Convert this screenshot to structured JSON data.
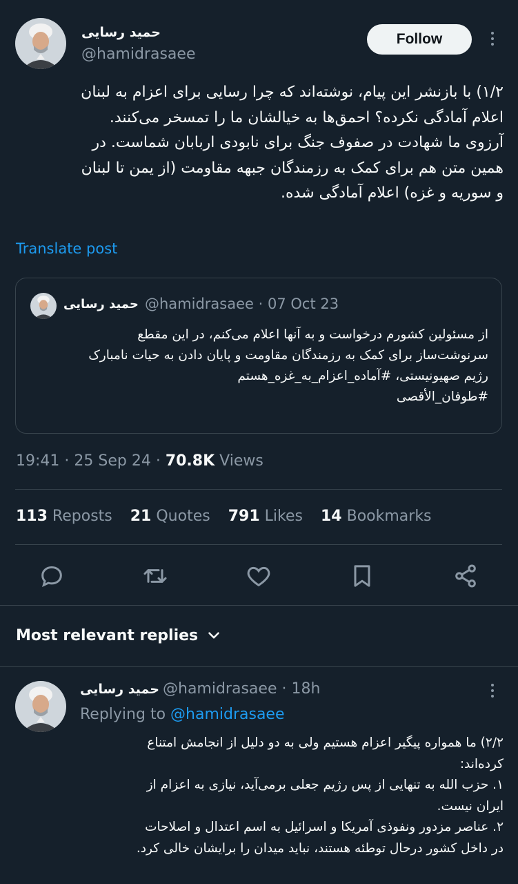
{
  "tweet": {
    "author_name": "حمید رسایی",
    "handle": "@hamidrasaee",
    "follow_label": "Follow",
    "text_lines": [
      "۱/۲) با بازنشر این پیام، نوشته‌اند که چرا رسایی برای اعزام به لبنان",
      "اعلام آمادگی نکرده؟ احمق‌ها به خیالشان ما را تمسخر می‌کنند.",
      "آرزوی ما شهادت در صفوف جنگ برای نابودی اربابان شماست. در",
      "همین متن هم برای کمک به رزمندگان جبهه مقاومت (از یمن تا لبنان",
      "و سوریه و غزه) اعلام آمادگی شده."
    ],
    "translate_label": "Translate post",
    "time": "19:41 · 25 Sep 24 · ",
    "views_count": "70.8K",
    "views_label": " Views"
  },
  "quote": {
    "author_name": "حمید رسایی",
    "handle_date": "@hamidrasaee · 07 Oct 23",
    "text_lines": [
      "از مسئولین کشورم درخواست و به آنها اعلام می‌کنم، در این مقطع",
      "سرنوشت‌ساز برای کمک به رزمندگان مقاومت و پایان دادن به حیات نامبارک",
      "رژیم صهیونیستی، #آماده_اعزام_به_غزه_هستم",
      "#طوفان_الأقصی"
    ]
  },
  "stats": [
    {
      "count": "113",
      "label": " Reposts"
    },
    {
      "count": "21",
      "label": " Quotes"
    },
    {
      "count": "791",
      "label": " Likes"
    },
    {
      "count": "14",
      "label": " Bookmarks"
    }
  ],
  "actions": [
    "reply-icon",
    "repost-icon",
    "like-icon",
    "bookmark-icon",
    "share-icon"
  ],
  "replies": {
    "section_title": "Most relevant replies",
    "reply": {
      "author_name": "حمید رسایی",
      "handle_time": "@hamidrasaee · 18h",
      "replying_to_label": "Replying to ",
      "replying_to_handle": "@hamidrasaee",
      "text_lines": [
        "۲/۲) ما همواره پیگیر اعزام هستیم ولی به دو دلیل از انجامش امتناع",
        "کرده‌اند:",
        "۱. حزب الله به تنهایی از پس رژیم جعلی برمی‌آید، نیازی به اعزام از",
        "ایران نیست.",
        "۲. عناصر مزدور ونفوذی آمریکا و اسرائیل به اسم اعتدال و اصلاحات",
        "در داخل کشور درحال توطئه هستند، نباید میدان را برایشان خالی کرد."
      ]
    }
  },
  "colors": {
    "background": "#15202b",
    "accent": "#1d9bf0",
    "muted": "#8b98a5",
    "divider": "#38444d"
  }
}
